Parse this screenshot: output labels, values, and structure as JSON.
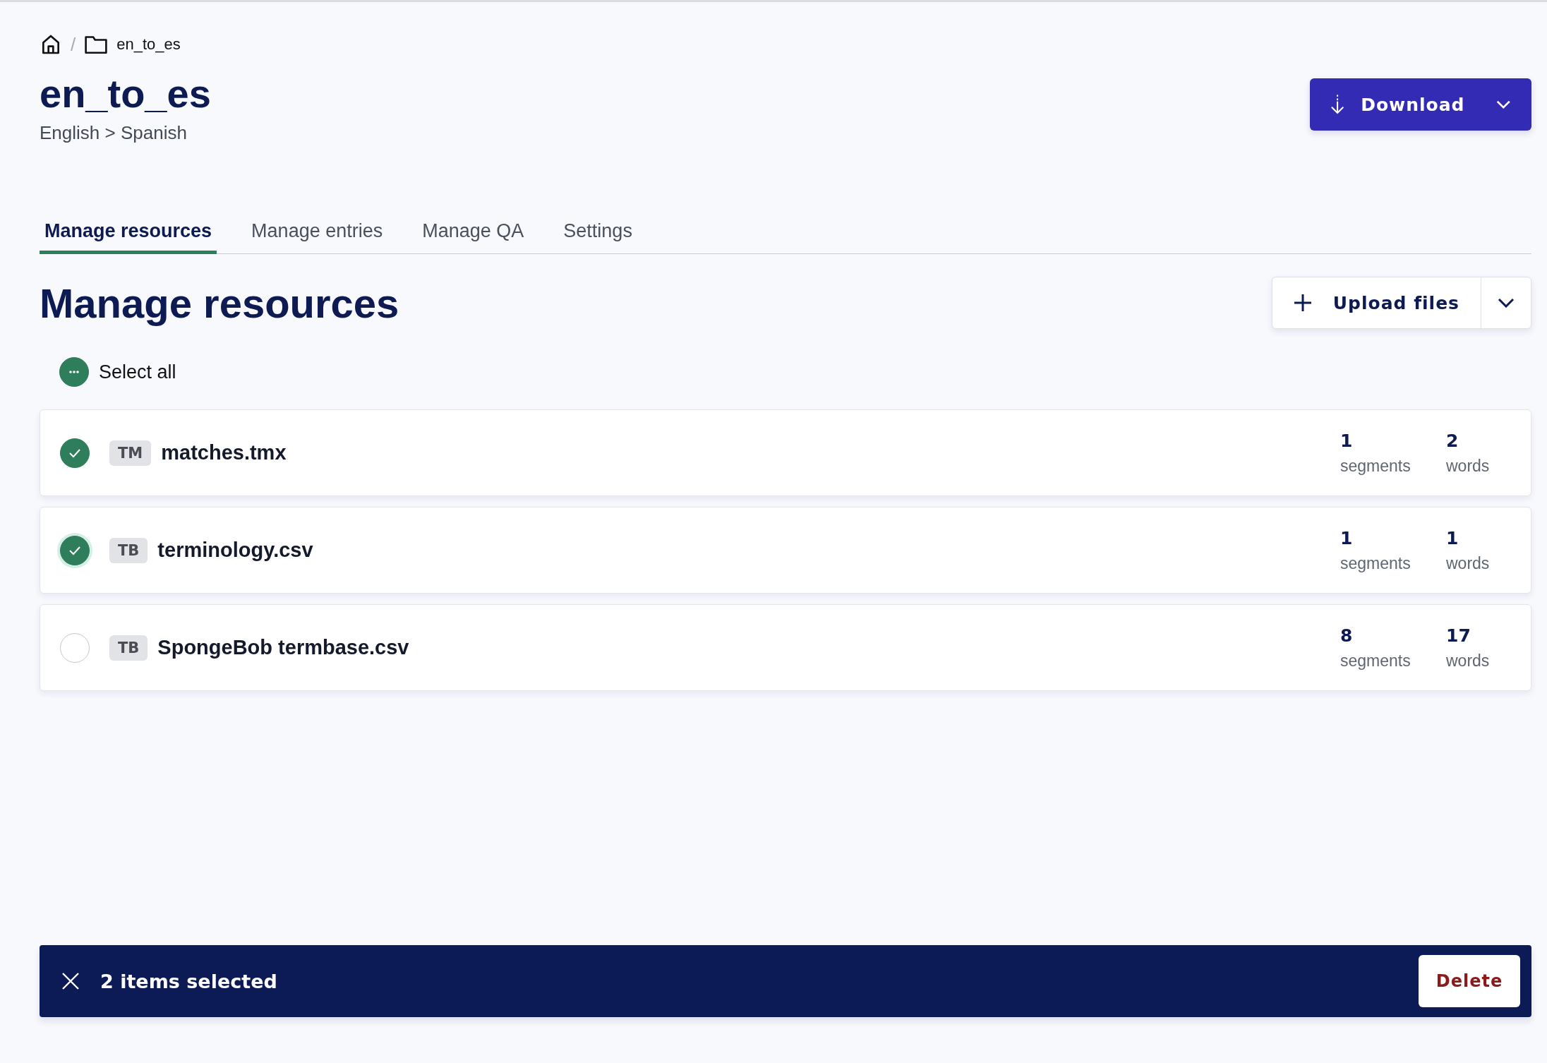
{
  "breadcrumb": {
    "separator": "/",
    "folder": "en_to_es"
  },
  "title": "en_to_es",
  "subtitle": "English > Spanish",
  "download_button": {
    "label": "Download"
  },
  "tabs": [
    {
      "label": "Manage resources",
      "selected": true
    },
    {
      "label": "Manage entries",
      "selected": false
    },
    {
      "label": "Manage QA",
      "selected": false
    },
    {
      "label": "Settings",
      "selected": false
    }
  ],
  "section_title": "Manage resources",
  "upload_button": {
    "label": "Upload files"
  },
  "select_all": {
    "label": "Select all",
    "checked": true,
    "partial": true
  },
  "resources": [
    {
      "type": "TM",
      "name": "matches.tmx",
      "checked": true,
      "focused": false,
      "segments": "1",
      "segments_label": "segments",
      "words": "2",
      "words_label": "words"
    },
    {
      "type": "TB",
      "name": "terminology.csv",
      "checked": true,
      "focused": true,
      "segments": "1",
      "segments_label": "segments",
      "words": "1",
      "words_label": "words"
    },
    {
      "type": "TB",
      "name": "SpongeBob termbase.csv",
      "checked": false,
      "focused": false,
      "segments": "8",
      "segments_label": "segments",
      "words": "17",
      "words_label": "words"
    }
  ],
  "selection_bar": {
    "text": "2 items selected",
    "action": "Delete"
  }
}
